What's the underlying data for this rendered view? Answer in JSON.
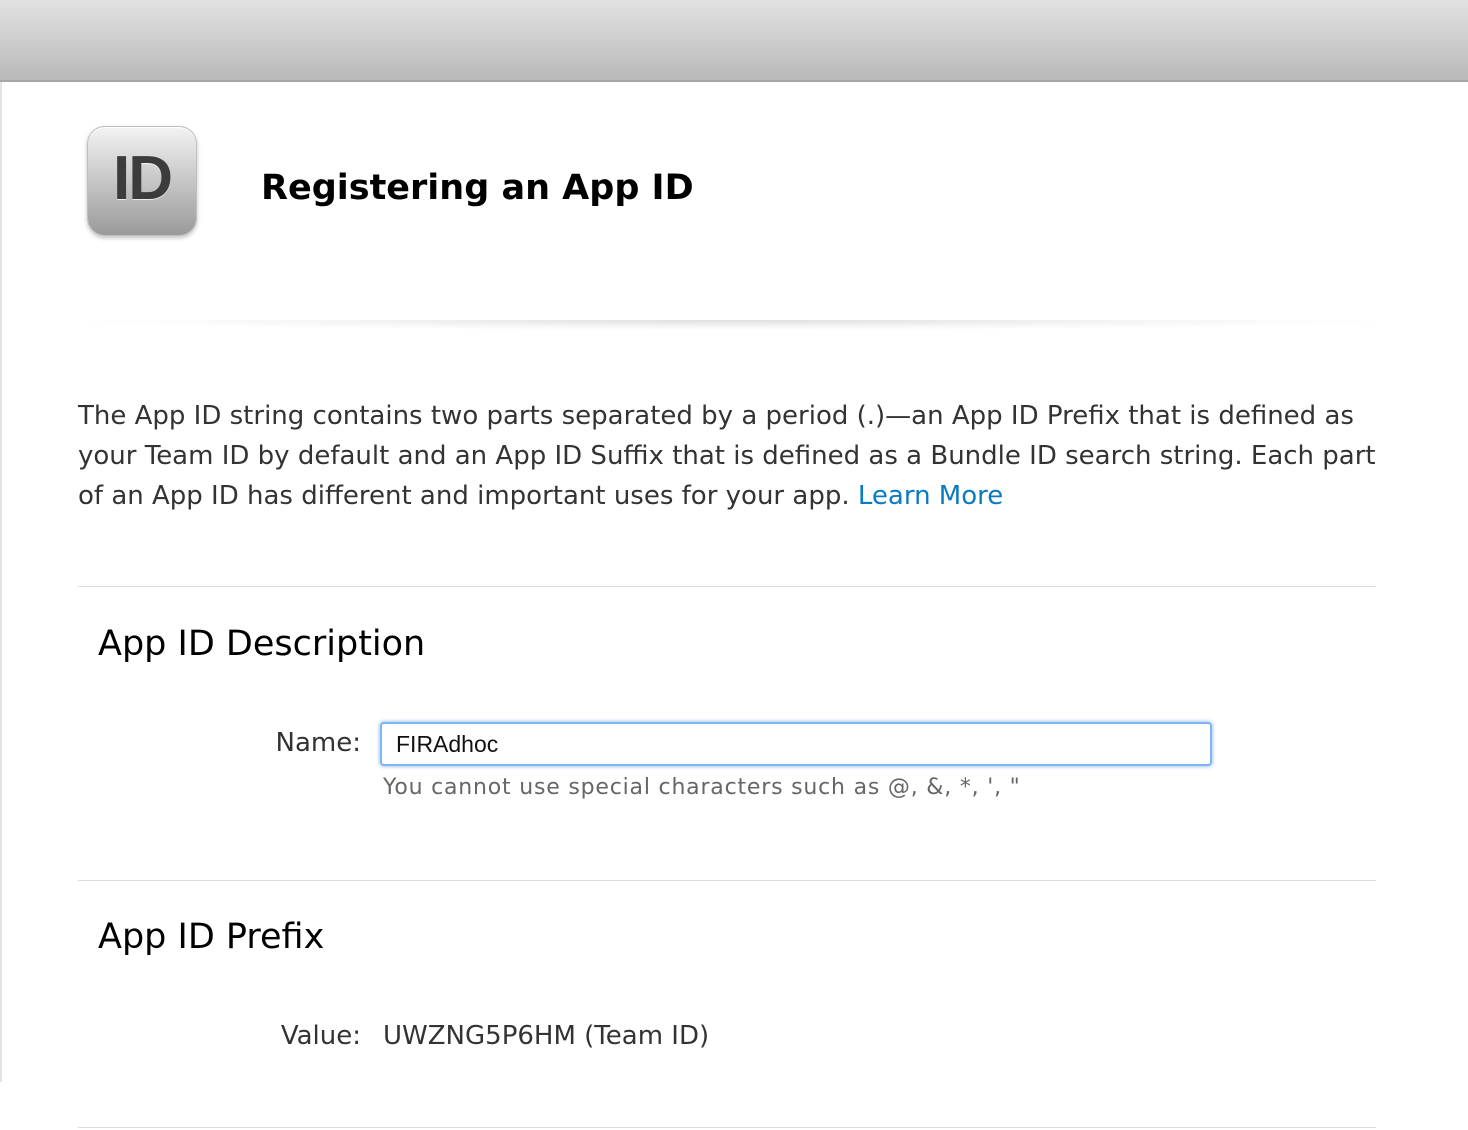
{
  "header": {
    "icon_text": "ID",
    "title": "Registering an App ID"
  },
  "intro": {
    "text": "The App ID string contains two parts separated by a period (.)—an App ID Prefix that is defined as your Team ID by default and an App ID Suffix that is defined as a Bundle ID search string. Each part of an App ID has different and important uses for your app.",
    "link_label": "Learn More"
  },
  "description_section": {
    "title": "App ID Description",
    "name_label": "Name:",
    "name_value": "FIRAdhoc",
    "hint": "You cannot use special characters such as @, &, *, ', \""
  },
  "prefix_section": {
    "title": "App ID Prefix",
    "value_label": "Value:",
    "value": "UWZNG5P6HM (Team ID)"
  },
  "colors": {
    "link": "#0b7bc1",
    "input_focus": "#7fb6f2"
  }
}
